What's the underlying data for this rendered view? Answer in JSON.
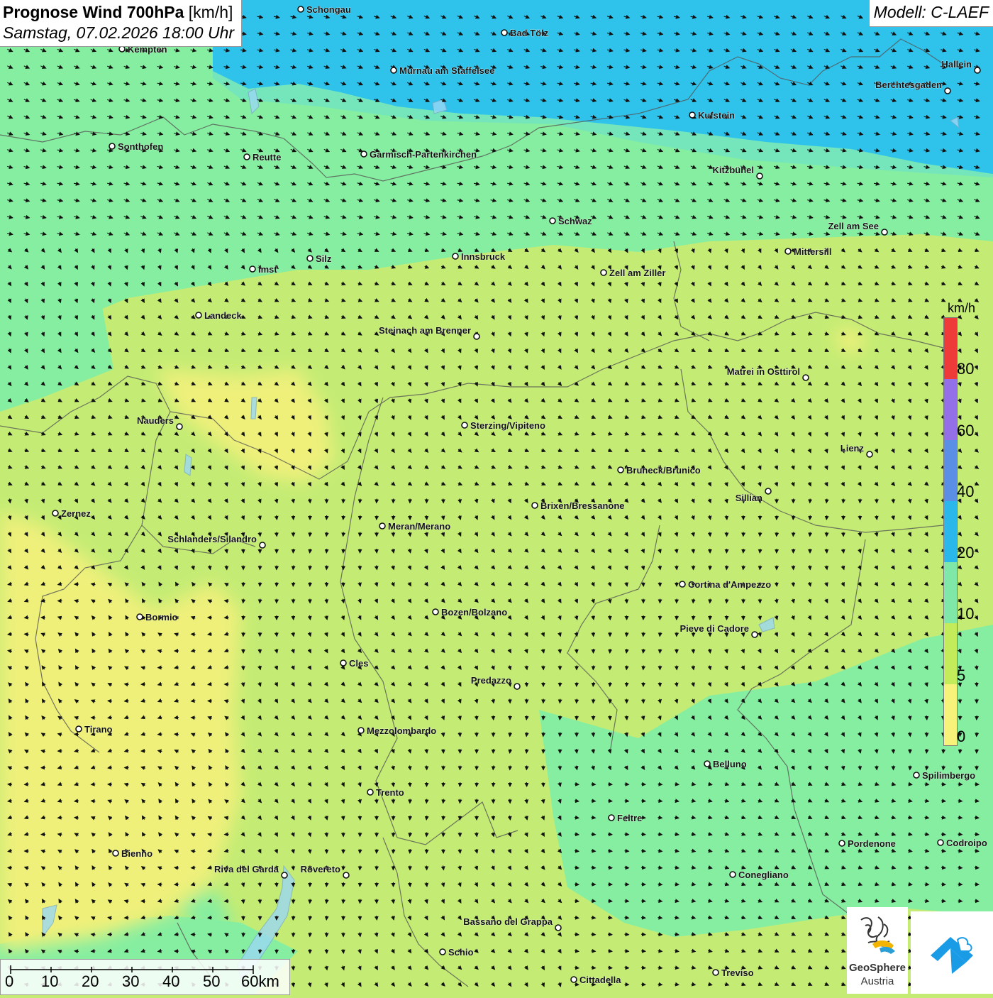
{
  "header": {
    "title": "Prognose Wind 700hPa",
    "unit": "[km/h]",
    "datetime": "Samstag, 07.02.2026 18:00 Uhr",
    "model": "Modell: C-LAEF"
  },
  "legend": {
    "unit": "km/h",
    "ticks": [
      "80",
      "60",
      "40",
      "20",
      "10",
      "5",
      "0"
    ],
    "colors": [
      "#ef3a3a",
      "#9370e8",
      "#5b8fe6",
      "#2ab8ec",
      "#7fe8a8",
      "#c4ec5a",
      "#f6f27a"
    ]
  },
  "scale": {
    "ticks": [
      "0",
      "10",
      "20",
      "30",
      "40",
      "50",
      "60km"
    ]
  },
  "logo": {
    "name_line1": "GeoSphere",
    "name_line2": "Austria"
  },
  "map_colors": {
    "blue": "#2fc3ec",
    "cyan": "#7de7d8",
    "mint": "#86eea0",
    "green": "#c4ec74",
    "yellow": "#eef07a"
  },
  "cities": [
    "Schongau",
    "Bad Tölz",
    "Kempten",
    "Murnau am Staffelsee",
    "Hallein",
    "Berchtesgaden",
    "Kufstein",
    "Sonthofen",
    "Reutte",
    "Garmisch-Partenkirchen",
    "Kitzbühel",
    "Schwaz",
    "Zell am See",
    "Mittersill",
    "Innsbruck",
    "Silz",
    "Imst",
    "Zell am Ziller",
    "Landeck",
    "Steinach am Brenner",
    "Matrei in Osttirol",
    "Nauders",
    "Sterzing/Vipiteno",
    "Lienz",
    "Bruneck/Brunico",
    "Sillian",
    "Zernez",
    "Brixen/Bressanone",
    "Meran/Merano",
    "Schlanders/Silandro",
    "Cortina d'Ampezzo",
    "Bozen/Bolzano",
    "Bormio",
    "Pieve di Cadore",
    "Cles",
    "Predazzo",
    "Tirano",
    "Mezzolombardo",
    "Belluno",
    "Spilimbergo",
    "Trento",
    "Feltre",
    "Bienno",
    "Pordenone",
    "Codroipo",
    "Riva del Garda",
    "Rovereto",
    "Conegliano",
    "Bassano del Grappa",
    "Schio",
    "Treviso",
    "Cittadella"
  ]
}
